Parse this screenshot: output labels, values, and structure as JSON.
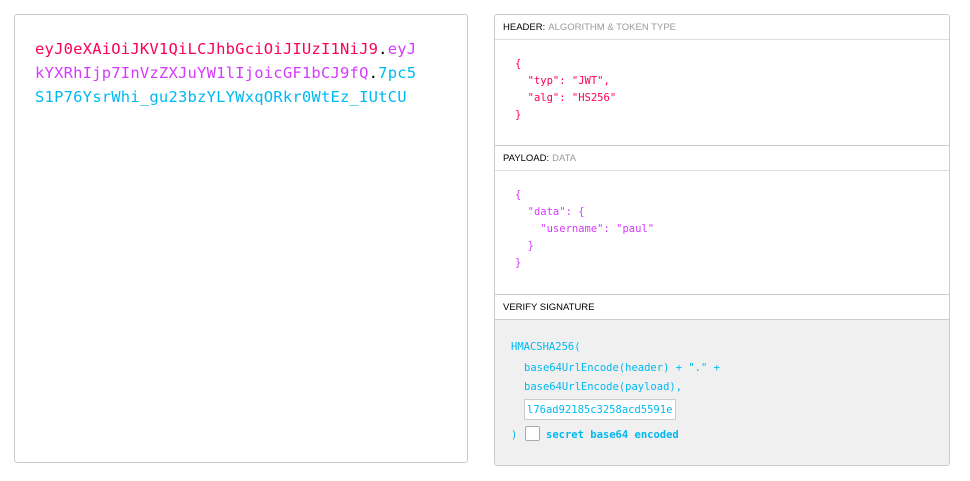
{
  "encoded": {
    "header_part": "eyJ0eXAiOiJKV1QiLCJhbGciOiJIUzI1NiJ9",
    "payload_part": "eyJkYXRhIjp7InVzZXJuYW1lIjoicGF1bCJ9fQ",
    "signature_part": "7pc5S1P76YsrWhi_gu23bzYLYWxqORkr0WtEz_IUtCU",
    "dot": "."
  },
  "header_section": {
    "title": "HEADER:",
    "subtitle": "ALGORITHM & TOKEN TYPE",
    "json_text": "{\n  \"typ\": \"JWT\",\n  \"alg\": \"HS256\"\n}"
  },
  "payload_section": {
    "title": "PAYLOAD:",
    "subtitle": "DATA",
    "json_text": "{\n  \"data\": {\n    \"username\": \"paul\"\n  }\n}"
  },
  "verify_section": {
    "title": "VERIFY SIGNATURE",
    "line1": "HMACSHA256(",
    "line2": "base64UrlEncode(header) + \".\" +",
    "line3": "base64UrlEncode(payload),",
    "secret_value": "l76ad92185c3258acd5591e",
    "close_paren": ")",
    "checkbox_label": "secret base64 encoded",
    "checkbox_checked": false
  },
  "colors": {
    "header": "#fb015b",
    "payload": "#d63aff",
    "signature": "#00b9f1"
  }
}
